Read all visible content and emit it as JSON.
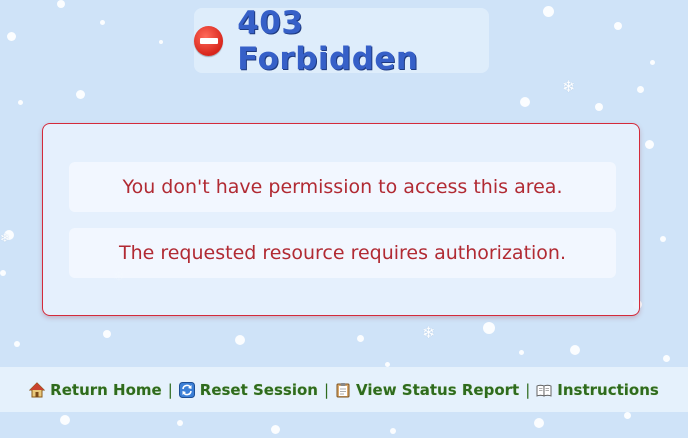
{
  "header": {
    "title": "403 Forbidden",
    "icon": "no-entry-icon"
  },
  "panel": {
    "messages": [
      "You don't have permission to access this area.",
      "The requested resource requires authorization."
    ]
  },
  "footer": {
    "links": [
      {
        "label": "Return Home",
        "icon": "house-icon"
      },
      {
        "label": "Reset Session",
        "icon": "refresh-icon"
      },
      {
        "label": "View Status Report",
        "icon": "clipboard-icon"
      },
      {
        "label": "Instructions",
        "icon": "book-icon"
      }
    ],
    "separator": "|"
  },
  "colors": {
    "background": "#cfe3f8",
    "title": "#3660c8",
    "message": "#b12a33",
    "border": "#d42a3a",
    "link": "#2e6b1e"
  }
}
